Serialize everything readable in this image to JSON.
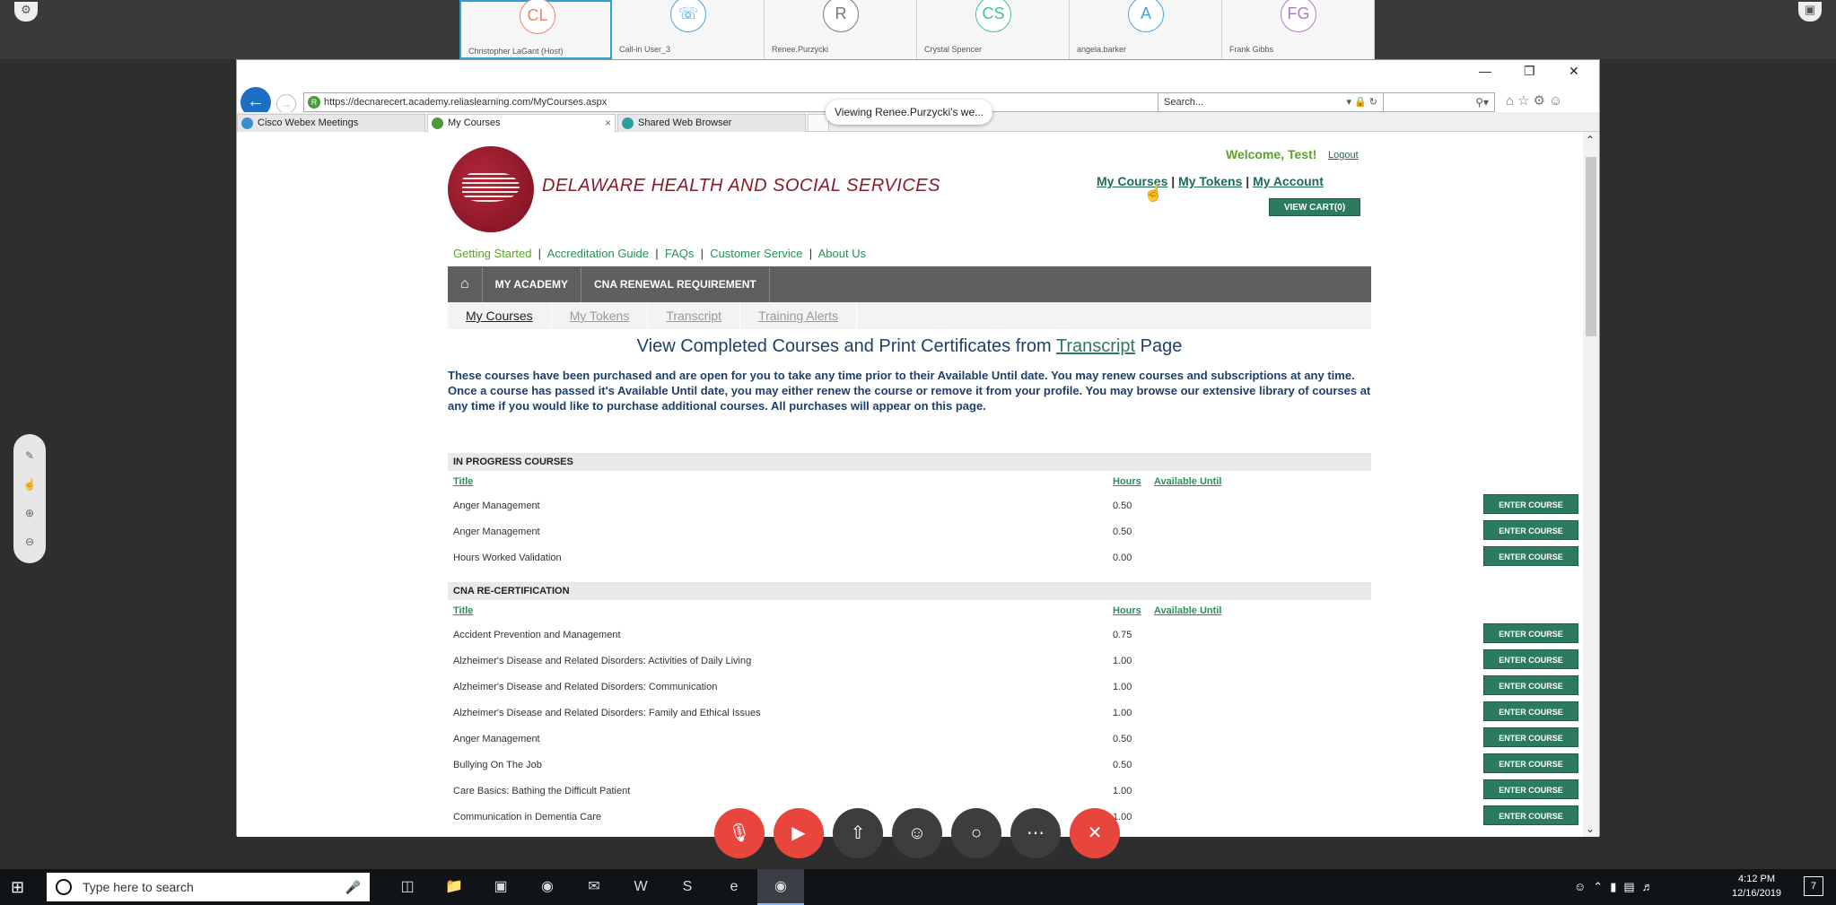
{
  "participants": [
    {
      "initials": "CL",
      "name": "Christopher LaGant (Host)",
      "color": "#e08a6c"
    },
    {
      "initials": "☏",
      "name": "Call-in User_3",
      "color": "#4aa3d8"
    },
    {
      "initials": "R",
      "name": "Renee.Purzycki",
      "color": "#777777"
    },
    {
      "initials": "CS",
      "name": "Crystal Spencer",
      "color": "#3fbf9a"
    },
    {
      "initials": "A",
      "name": "angela.barker",
      "color": "#4aa3d8"
    },
    {
      "initials": "FG",
      "name": "Frank Gibbs",
      "color": "#b07ac9"
    }
  ],
  "browser": {
    "url": "https://decnarecert.academy.reliaslearning.com/MyCourses.aspx",
    "viewing_tooltip": "Viewing Renee.Purzycki's we...",
    "search_placeholder": "Search...",
    "tabs": [
      {
        "label": "Cisco Webex Meetings"
      },
      {
        "label": "My Courses"
      },
      {
        "label": "Shared Web Browser"
      }
    ]
  },
  "page": {
    "brand": "DELAWARE HEALTH AND SOCIAL SERVICES",
    "welcome": "Welcome, Test!",
    "logout": "Logout",
    "top_links": [
      "My Courses",
      "My Tokens",
      "My Account"
    ],
    "view_cart": "VIEW CART(0)",
    "nav_links": [
      "Getting Started",
      "Accreditation Guide",
      "FAQs",
      "Customer Service",
      "About Us"
    ],
    "nav_bar": [
      "MY ACADEMY",
      "CNA RENEWAL REQUIREMENT"
    ],
    "sub_tabs": [
      "My Courses",
      "My Tokens",
      "Transcript",
      "Training Alerts"
    ],
    "heading_pre": "View Completed Courses and Print Certificates from ",
    "heading_link": "Transcript",
    "heading_post": " Page",
    "intro": "These courses have been purchased and are open for you to take any time prior to their Available Until date. You may renew courses and subscriptions at any time. Once a course has passed it's Available Until date, you may either renew the course or remove it from your profile. You may browse our extensive library of courses at any time if you would like to purchase additional courses. All purchases will appear on this page.",
    "columns": {
      "title": "Title",
      "hours": "Hours",
      "available_until": "Available Until"
    },
    "enter_course": "ENTER COURSE",
    "in_progress": {
      "header": "IN PROGRESS COURSES",
      "rows": [
        {
          "title": "Anger Management",
          "hours": "0.50"
        },
        {
          "title": "Anger Management",
          "hours": "0.50"
        },
        {
          "title": "Hours Worked Validation",
          "hours": "0.00"
        }
      ]
    },
    "cna": {
      "header": "CNA RE-CERTIFICATION",
      "rows": [
        {
          "title": "Accident Prevention and Management",
          "hours": "0.75"
        },
        {
          "title": "Alzheimer's Disease and Related Disorders: Activities of Daily Living",
          "hours": "1.00"
        },
        {
          "title": "Alzheimer's Disease and Related Disorders: Communication",
          "hours": "1.00"
        },
        {
          "title": "Alzheimer's Disease and Related Disorders: Family and Ethical Issues",
          "hours": "1.00"
        },
        {
          "title": "Anger Management",
          "hours": "0.50"
        },
        {
          "title": "Bullying On The Job",
          "hours": "0.50"
        },
        {
          "title": "Care Basics: Bathing the Difficult Patient",
          "hours": "1.00"
        },
        {
          "title": "Communication in Dementia Care",
          "hours": "1.00"
        }
      ]
    }
  },
  "taskbar": {
    "search_placeholder": "Type here to search",
    "time": "4:12 PM",
    "date": "12/16/2019",
    "notification_count": "7"
  }
}
